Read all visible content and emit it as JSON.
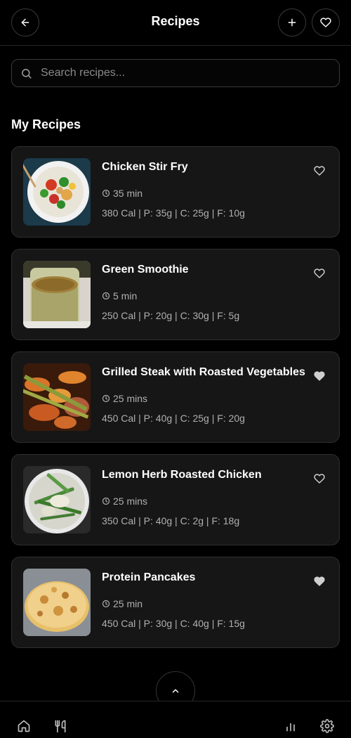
{
  "header": {
    "title": "Recipes",
    "back_icon": "arrow-left-icon",
    "add_icon": "plus-icon",
    "favorites_icon": "heart-icon"
  },
  "search": {
    "placeholder": "Search recipes...",
    "value": ""
  },
  "section": {
    "title": "My Recipes"
  },
  "recipes": [
    {
      "name": "Chicken Stir Fry",
      "time": "35 min",
      "macros": "380 Cal | P: 35g | C: 25g | F: 10g",
      "favorited": false
    },
    {
      "name": "Green Smoothie",
      "time": "5 min",
      "macros": "250 Cal | P: 20g | C: 30g | F: 5g",
      "favorited": false
    },
    {
      "name": "Grilled Steak with Roasted Vegetables",
      "time": "25 mins",
      "macros": "450 Cal | P: 40g | C: 25g | F: 20g",
      "favorited": true
    },
    {
      "name": "Lemon Herb Roasted Chicken",
      "time": "25 mins",
      "macros": "350 Cal | P: 40g | C: 2g | F: 18g",
      "favorited": false
    },
    {
      "name": "Protein Pancakes",
      "time": "25 min",
      "macros": "450 Cal | P: 30g | C: 40g | F: 15g",
      "favorited": true
    }
  ],
  "bottom_nav": {
    "items": [
      "home-icon",
      "utensils-icon",
      "bar-chart-icon",
      "settings-icon"
    ]
  },
  "colors": {
    "background": "#000000",
    "card": "#161616",
    "border": "#2e2e2e",
    "text": "#ffffff",
    "muted": "#b0b0b0"
  }
}
